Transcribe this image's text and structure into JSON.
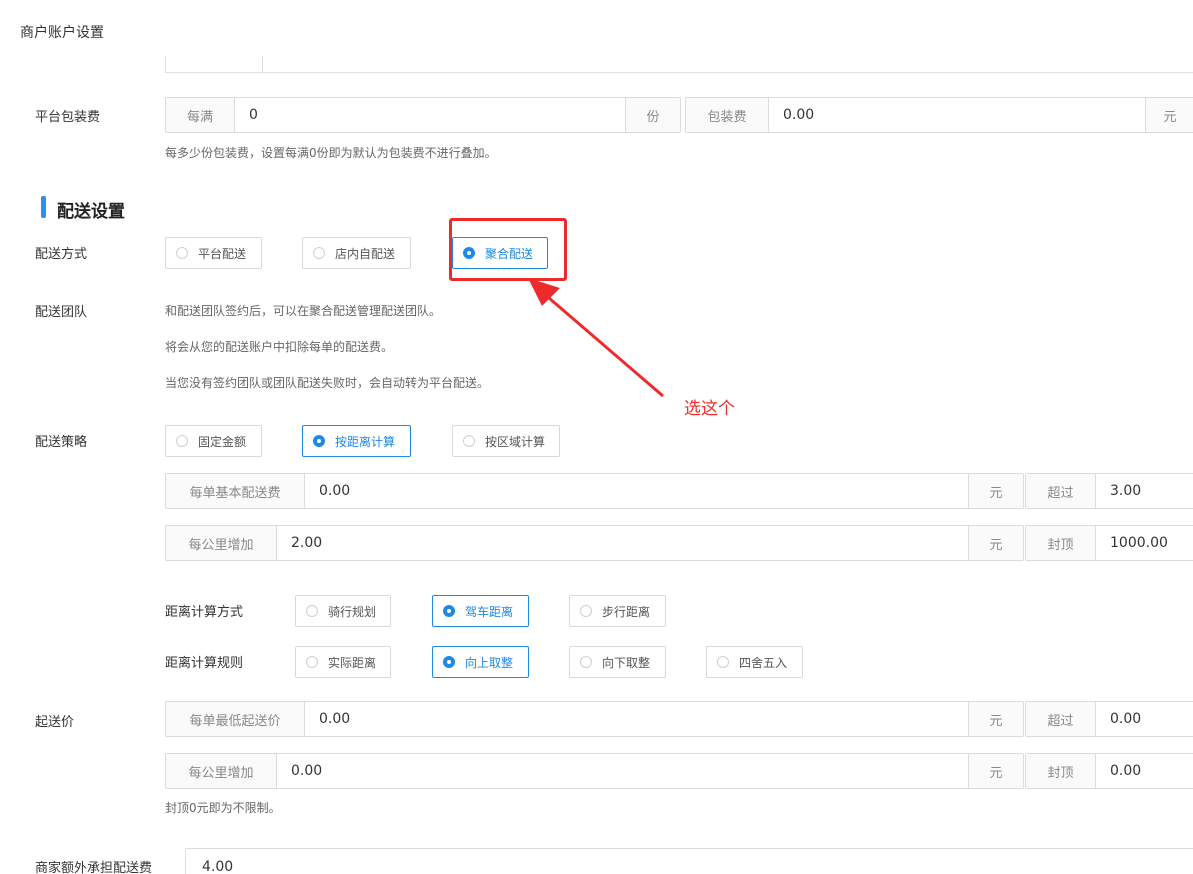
{
  "page": {
    "title": "商户账户设置"
  },
  "packaging": {
    "label": "平台包装费",
    "per_prefix": "每满",
    "per_value": "0",
    "per_suffix": "份",
    "fee_prefix": "包装费",
    "fee_value": "0.00",
    "fee_suffix": "元",
    "hint": "每多少份包装费，设置每满0份即为默认为包装费不进行叠加。"
  },
  "delivery_section": {
    "title": "配送设置"
  },
  "delivery_method": {
    "label": "配送方式",
    "options": [
      "平台配送",
      "店内自配送",
      "聚合配送"
    ],
    "selected": "聚合配送"
  },
  "delivery_team": {
    "label": "配送团队",
    "lines": [
      "和配送团队签约后，可以在聚合配送管理配送团队。",
      "将会从您的配送账户中扣除每单的配送费。",
      "当您没有签约团队或团队配送失败时，会自动转为平台配送。"
    ]
  },
  "annotation": {
    "text": "选这个",
    "color": "#ee2b2b"
  },
  "strategy": {
    "label": "配送策略",
    "options": [
      "固定金额",
      "按距离计算",
      "按区域计算"
    ],
    "selected": "按距离计算",
    "base_fee": {
      "prefix": "每单基本配送费",
      "value": "0.00",
      "suffix": "元",
      "over_prefix": "超过",
      "over_value": "3.00"
    },
    "per_km": {
      "prefix": "每公里增加",
      "value": "2.00",
      "suffix": "元",
      "cap_prefix": "封顶",
      "cap_value": "1000.00"
    },
    "calc_method": {
      "label": "距离计算方式",
      "options": [
        "骑行规划",
        "驾车距离",
        "步行距离"
      ],
      "selected": "驾车距离"
    },
    "calc_rule": {
      "label": "距离计算规则",
      "options": [
        "实际距离",
        "向上取整",
        "向下取整",
        "四舍五入"
      ],
      "selected": "向上取整"
    }
  },
  "min_order": {
    "label": "起送价",
    "base": {
      "prefix": "每单最低起送价",
      "value": "0.00",
      "suffix": "元",
      "over_prefix": "超过",
      "over_value": "0.00"
    },
    "per_km": {
      "prefix": "每公里增加",
      "value": "0.00",
      "suffix": "元",
      "cap_prefix": "封顶",
      "cap_value": "0.00"
    },
    "hint": "封顶0元即为不限制。"
  },
  "merchant_extra": {
    "label": "商家额外承担配送费",
    "value": "4.00"
  },
  "colors": {
    "accent": "#1e88e5",
    "section_bar": "#2f8ff0",
    "annotation": "#ee2b2b"
  }
}
